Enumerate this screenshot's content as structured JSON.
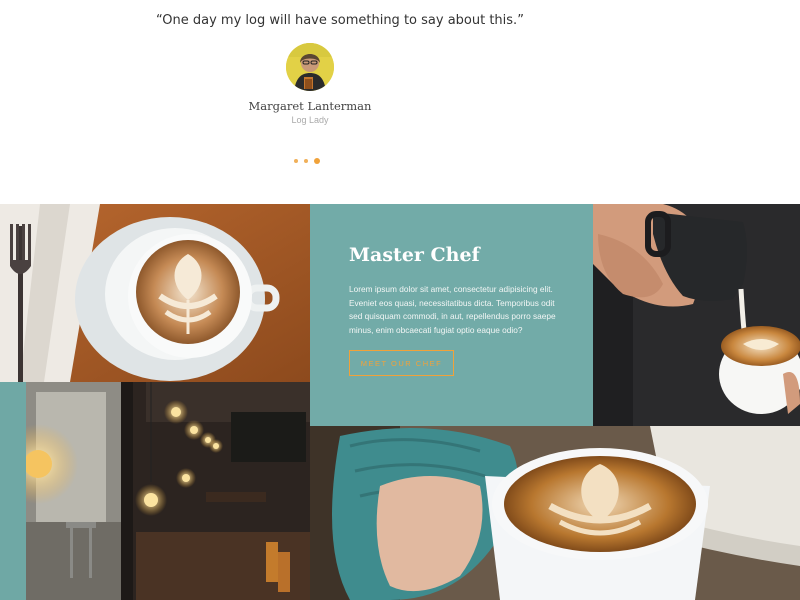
{
  "testimonial": {
    "quote": "“One day my log will have something to say about this.”",
    "author": "Margaret Lanterman",
    "role": "Log Lady",
    "pagination": {
      "total": 3,
      "active": 3
    }
  },
  "chef": {
    "title": "Master Chef",
    "text": "Lorem ipsum dolor sit amet, consectetur adipisicing elit. Eveniet eos quasi, necessitatibus dicta. Temporibus odit sed quisquam commodi, in aut, repellendus porro saepe minus, enim obcaecati fugiat optio eaque odio?",
    "button_label": "MEET OUR CHEF"
  },
  "colors": {
    "accent": "#f0a23a",
    "panel_teal": "#72aba8"
  }
}
